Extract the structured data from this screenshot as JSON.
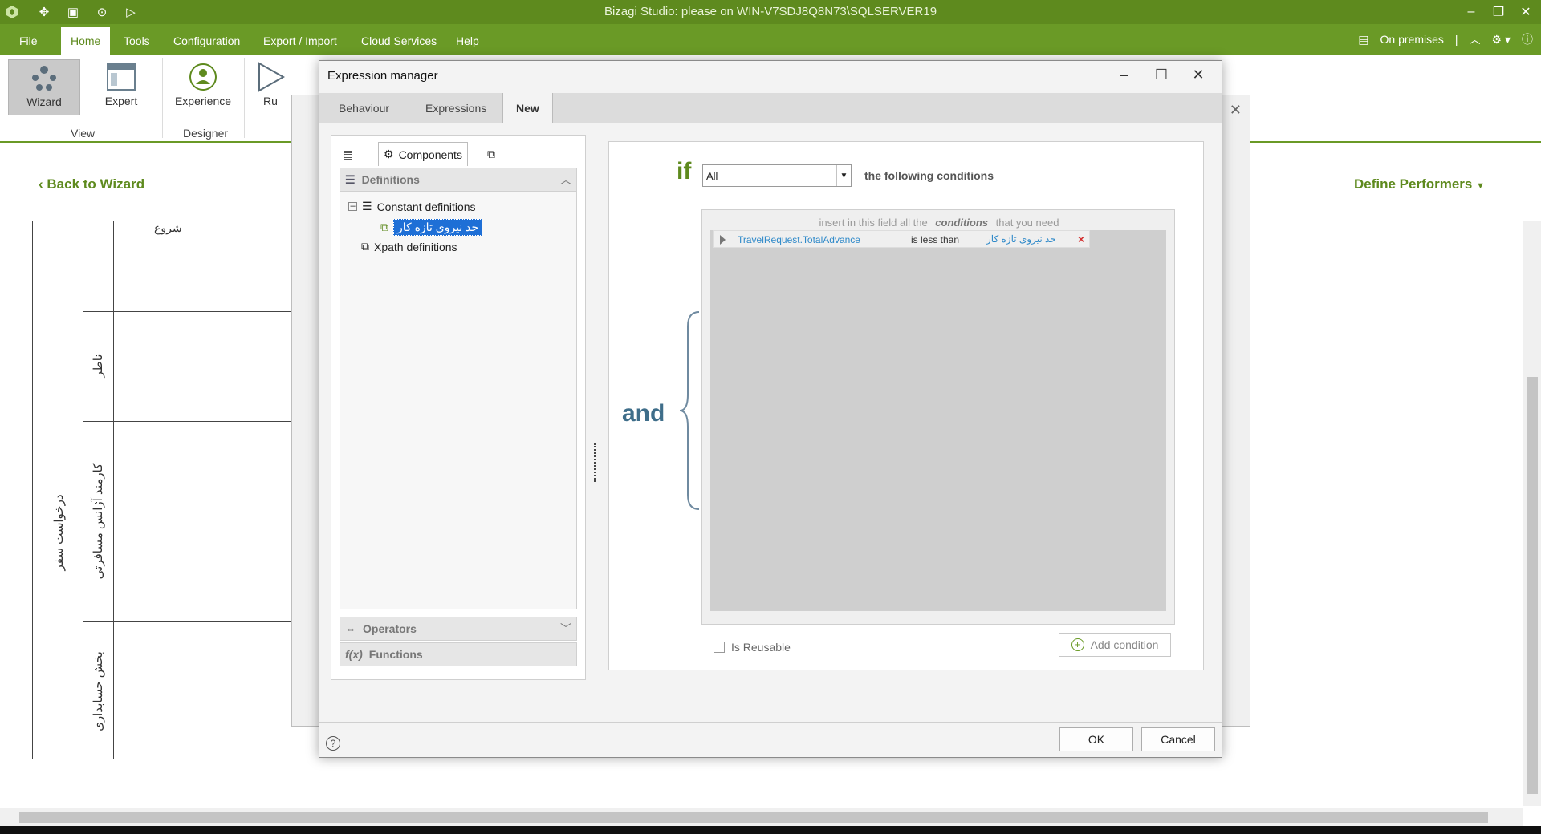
{
  "app": {
    "title": "Bizagi Studio: please  on WIN-V7SDJ8Q8N73\\SQLSERVER19"
  },
  "menu": {
    "items": [
      "File",
      "Home",
      "Tools",
      "Configuration",
      "Export / Import",
      "Cloud Services",
      "Help"
    ],
    "right_label": "On premises"
  },
  "ribbon": {
    "wizard": "Wizard",
    "expert": "Expert",
    "experience": "Experience",
    "run": "Ru",
    "group_view": "View",
    "group_designer": "Designer"
  },
  "canvas": {
    "back_link": "Back to Wizard",
    "define_performers": "Define Performers",
    "pool_title": "درخواست سفر",
    "lanes": [
      "ناظر",
      "کارمند آژانس مسافرتی",
      "بخش حسابداری"
    ],
    "start_label": "شروع"
  },
  "dialog": {
    "title": "Expression manager",
    "tabs": [
      "Behaviour",
      "Expressions",
      "New"
    ],
    "active_tab": "New",
    "left": {
      "components_tab": "Components",
      "definitions": "Definitions",
      "constant_definitions": "Constant definitions",
      "selected_item": "حد نیروی تازه کار",
      "xpath_definitions": "Xpath definitions",
      "operators": "Operators",
      "functions": "Functions"
    },
    "right": {
      "if_label": "if",
      "match_value": "All",
      "following": "the following conditions",
      "and_label": "and",
      "hint_pre": "insert in this field all the",
      "hint_conditions": "conditions",
      "hint_post": "that you need",
      "condition": {
        "field": "TravelRequest.TotalAdvance",
        "operator": "is less than",
        "value": "حد نیروی تازه کار"
      },
      "is_reusable": "Is Reusable",
      "add_condition": "Add condition"
    },
    "ok": "OK",
    "cancel": "Cancel"
  }
}
